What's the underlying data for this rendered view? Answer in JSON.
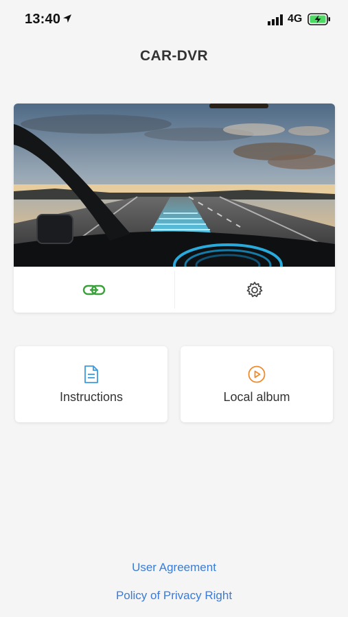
{
  "status_bar": {
    "time": "13:40",
    "network": "4G",
    "icons": [
      "location-arrow-icon",
      "signal-icon",
      "battery-charging-icon"
    ]
  },
  "header": {
    "title": "CAR-DVR"
  },
  "camera_card": {
    "image": "dashcam-road-hero",
    "actions": [
      {
        "icon": "link-icon",
        "color": "#3aa13a"
      },
      {
        "icon": "gear-icon",
        "color": "#444444"
      }
    ]
  },
  "tiles": [
    {
      "label": "Instructions",
      "icon": "document-icon",
      "color": "#3b9be0"
    },
    {
      "label": "Local album",
      "icon": "play-circle-icon",
      "color": "#f08a2b"
    }
  ],
  "footer": {
    "agreement": "User Agreement",
    "privacy": "Policy of Privacy Right"
  }
}
